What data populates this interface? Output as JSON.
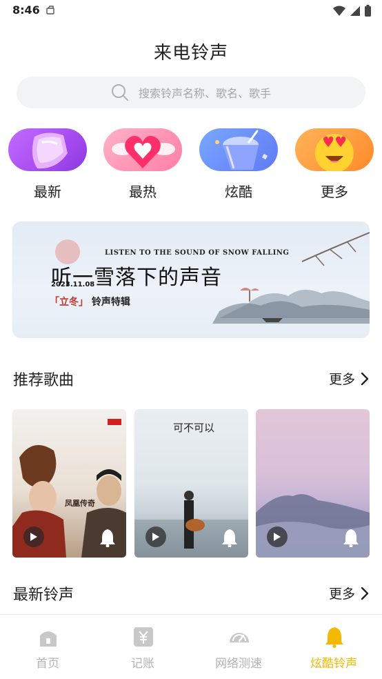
{
  "status_bar": {
    "time": "8:46"
  },
  "page": {
    "title": "来电铃声"
  },
  "search": {
    "placeholder": "搜索铃声名称、歌名、歌手"
  },
  "categories": [
    {
      "label": "最新",
      "icon": "gem-icon"
    },
    {
      "label": "最热",
      "icon": "heart-icon"
    },
    {
      "label": "炫酷",
      "icon": "cup-icon"
    },
    {
      "label": "更多",
      "icon": "heart-eyes-emoji-icon"
    }
  ],
  "banner": {
    "en_title": "LISTEN TO THE SOUND OF SNOW FALLING",
    "cn_title": "听一雪落下的声音",
    "date": "2023.11.08",
    "subtitle_highlight": "「立冬」",
    "subtitle_rest": "铃声特辑"
  },
  "recommended": {
    "title": "推荐歌曲",
    "more_label": "更多",
    "albums": [
      {
        "cover_text": "凤凰传奇",
        "icon_play": "play-icon",
        "icon_bell": "bell-icon"
      },
      {
        "cover_text": "可不可以",
        "icon_play": "play-icon",
        "icon_bell": "bell-icon"
      },
      {
        "icon_play": "play-icon",
        "icon_bell": "bell-icon"
      }
    ]
  },
  "latest": {
    "title": "最新铃声",
    "more_label": "更多"
  },
  "tabs": [
    {
      "label": "首页",
      "icon": "home-icon",
      "active": false
    },
    {
      "label": "记账",
      "icon": "yen-icon",
      "active": false
    },
    {
      "label": "网络测速",
      "icon": "speedometer-icon",
      "active": false
    },
    {
      "label": "炫酷铃声",
      "icon": "bell-icon",
      "active": true
    }
  ],
  "colors": {
    "accent": "#f5b800",
    "inactive_tab": "#b3b3b3",
    "search_bg": "#f2f3f5"
  }
}
